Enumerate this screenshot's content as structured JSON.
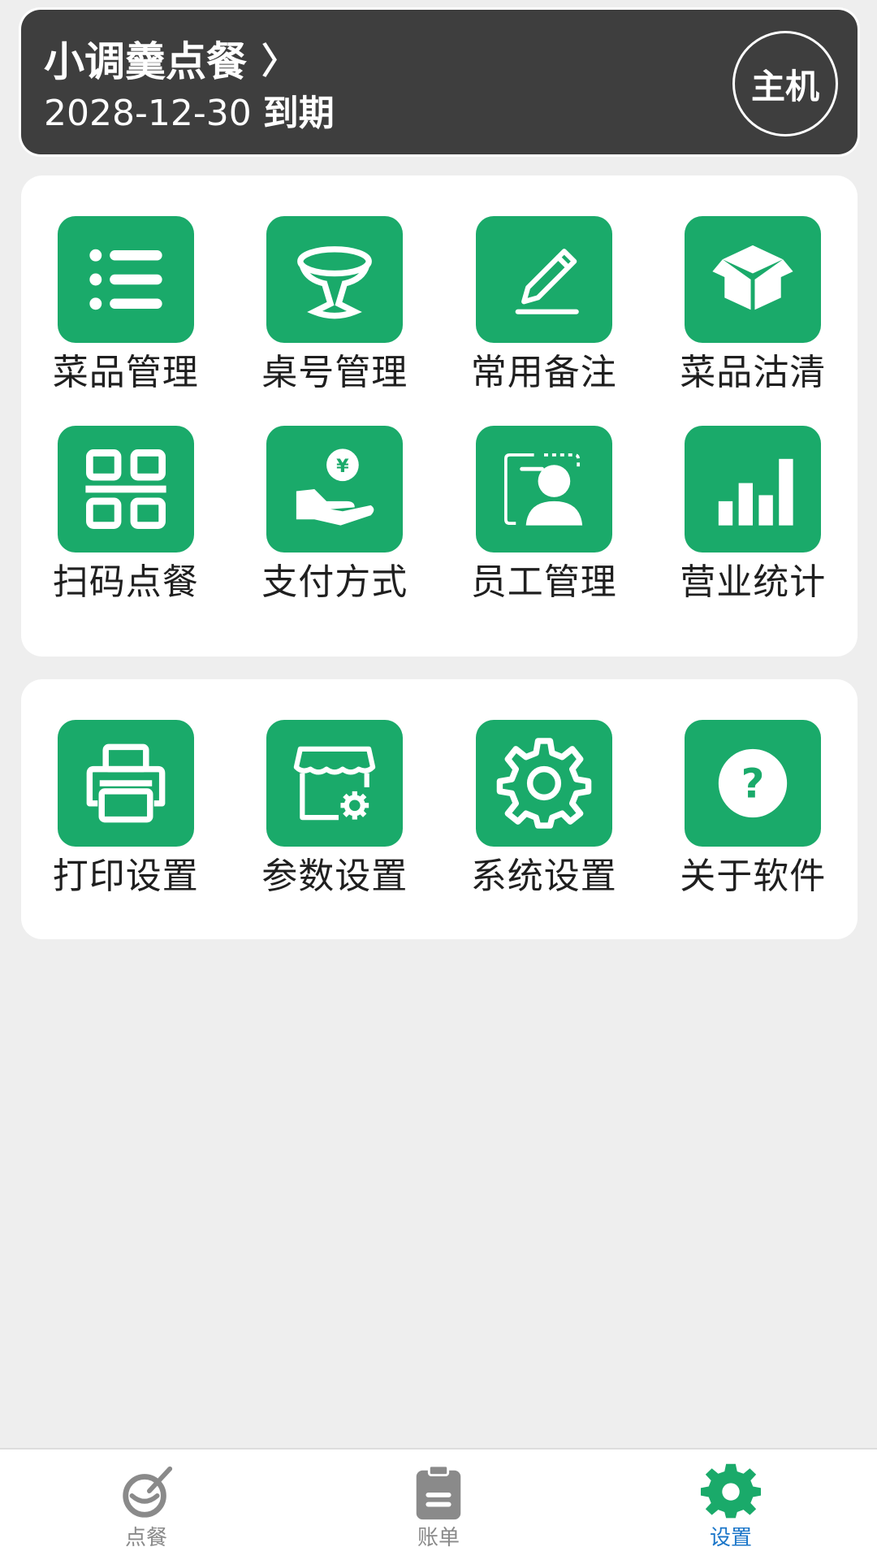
{
  "header": {
    "store_name": "小调羹点餐",
    "chevron": "〉",
    "expire_date": "2028-12-30",
    "expire_suffix": "到期",
    "host_label": "主机"
  },
  "main_grid": [
    {
      "label": "菜品管理",
      "icon": "list-icon"
    },
    {
      "label": "桌号管理",
      "icon": "table-icon"
    },
    {
      "label": "常用备注",
      "icon": "pencil-icon"
    },
    {
      "label": "菜品沽清",
      "icon": "box-icon"
    },
    {
      "label": "扫码点餐",
      "icon": "qr-code-icon"
    },
    {
      "label": "支付方式",
      "icon": "payment-hand-icon"
    },
    {
      "label": "员工管理",
      "icon": "employee-icon"
    },
    {
      "label": "营业统计",
      "icon": "bar-chart-icon"
    }
  ],
  "settings_grid": [
    {
      "label": "打印设置",
      "icon": "printer-icon"
    },
    {
      "label": "参数设置",
      "icon": "store-gear-icon"
    },
    {
      "label": "系统设置",
      "icon": "gear-icon"
    },
    {
      "label": "关于软件",
      "icon": "question-icon"
    }
  ],
  "bottom_nav": [
    {
      "label": "点餐",
      "icon": "bowl-icon",
      "active": false
    },
    {
      "label": "账单",
      "icon": "clipboard-icon",
      "active": false
    },
    {
      "label": "设置",
      "icon": "gear-icon",
      "active": true
    }
  ],
  "colors": {
    "accent_green": "#1aaa6a",
    "header_bg": "#3e3e3e",
    "active_nav_text": "#1b76c9",
    "inactive_nav": "#8a8a8a",
    "page_bg": "#eeeeee"
  }
}
